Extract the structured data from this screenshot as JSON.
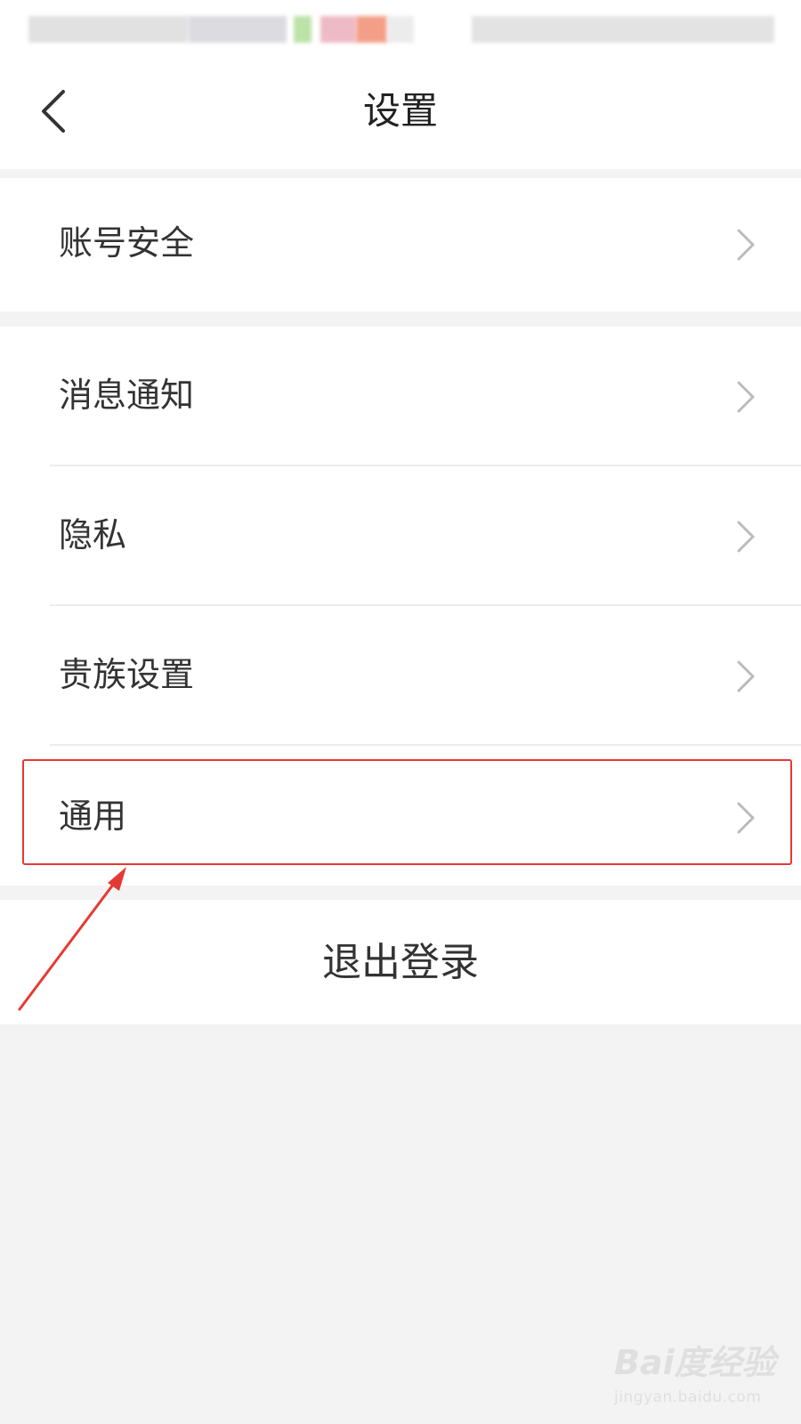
{
  "header": {
    "title": "设置",
    "back_icon": "chevron-left-icon"
  },
  "menu": {
    "account_security": "账号安全",
    "notifications": "消息通知",
    "privacy": "隐私",
    "noble_settings": "贵族设置",
    "general": "通用"
  },
  "logout": {
    "label": "退出登录"
  },
  "colors": {
    "background": "#f3f3f3",
    "surface": "#ffffff",
    "text": "#333333",
    "chevron": "#bbbbbb",
    "annotation": "#e53935"
  },
  "watermark": {
    "logo": "Bai度经验",
    "url": "jingyan.baidu.com"
  }
}
